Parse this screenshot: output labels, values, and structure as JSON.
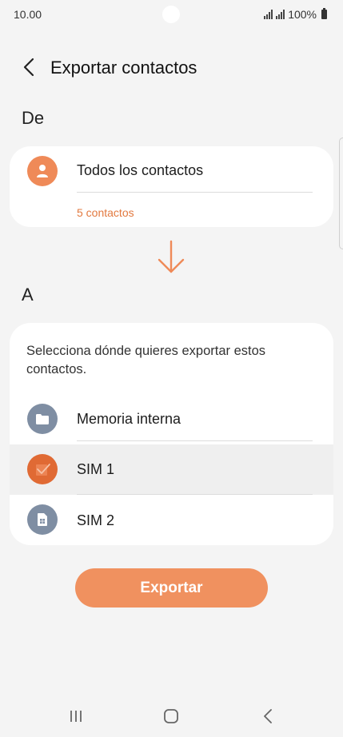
{
  "status_bar": {
    "time": "10.00",
    "battery": "100%"
  },
  "header": {
    "title": "Exportar contactos"
  },
  "from_section": {
    "label": "De",
    "source": {
      "label": "Todos los contactos",
      "count": "5 contactos"
    }
  },
  "to_section": {
    "label": "A",
    "instruction": "Selecciona dónde quieres exportar estos contactos.",
    "options": [
      {
        "label": "Memoria interna",
        "icon": "folder-icon",
        "selected": false
      },
      {
        "label": "SIM 1",
        "icon": "check-icon",
        "selected": true
      },
      {
        "label": "SIM 2",
        "icon": "sim-card-icon",
        "selected": false
      }
    ]
  },
  "export_button": {
    "label": "Exportar"
  },
  "colors": {
    "accent": "#f0915f",
    "accent_dark": "#e06a34",
    "link": "#e2793f",
    "icon_gray": "#7f8ea3",
    "background": "#f4f4f4"
  }
}
